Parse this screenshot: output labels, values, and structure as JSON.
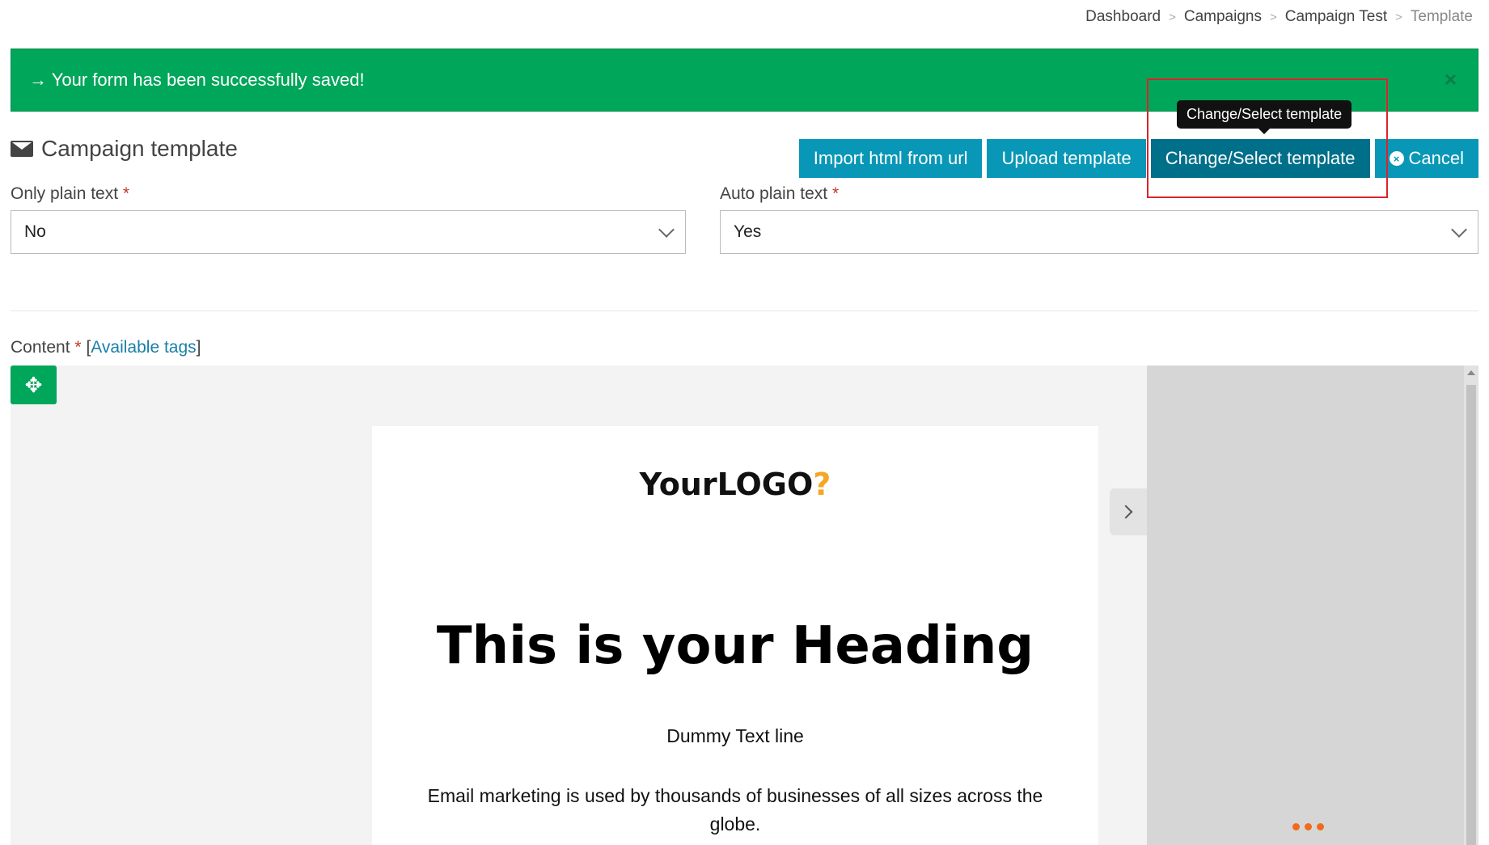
{
  "breadcrumb": {
    "items": [
      "Dashboard",
      "Campaigns",
      "Campaign Test"
    ],
    "current": "Template",
    "separator": ">"
  },
  "alert": {
    "message": "→ Your form has been successfully saved!",
    "close": "×",
    "color": "#00a65a"
  },
  "page": {
    "title": "Campaign template"
  },
  "toolbar": {
    "import_label": "Import html from url",
    "upload_label": "Upload template",
    "change_label": "Change/Select template",
    "cancel_label": "Cancel",
    "button_color": "#0897b6"
  },
  "tooltip": {
    "text": "Change/Select template"
  },
  "form": {
    "only_plain_text": {
      "label": "Only plain text",
      "required": "*",
      "value": "No"
    },
    "auto_plain_text": {
      "label": "Auto plain text",
      "required": "*",
      "value": "Yes"
    }
  },
  "content": {
    "label": "Content",
    "required": "*",
    "tags_open": "[",
    "tags_link": "Available tags",
    "tags_close": "]"
  },
  "email": {
    "logo_part1": "Your",
    "logo_part2": "LOGO",
    "logo_part3": "?",
    "heading": "This is your Heading",
    "dummy_line": "Dummy Text line",
    "paragraph": "Email marketing is used by thousands of businesses of all sizes across the globe."
  },
  "icons": {
    "envelope": "envelope-icon",
    "move": "move-arrows-icon",
    "cancel": "times-circle-icon",
    "panel_toggle": "chevron-right-icon",
    "loading": "loading-dots-icon"
  }
}
